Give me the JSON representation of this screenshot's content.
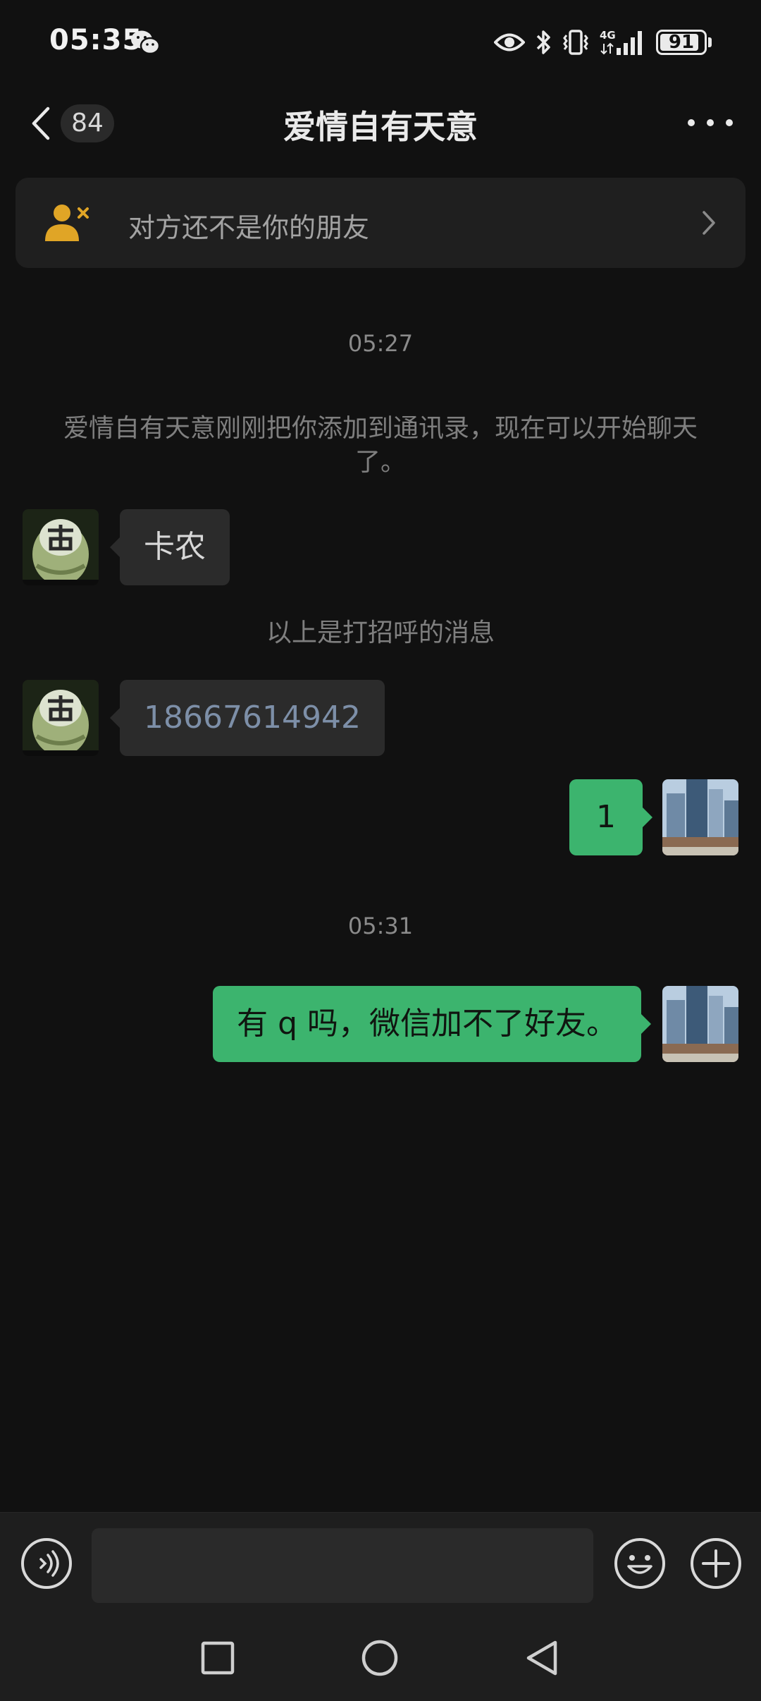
{
  "status_bar": {
    "time": "05:35",
    "battery": "91",
    "battery_level": 0.91,
    "network": "4G",
    "icons": [
      "wechat-icon",
      "eye-icon",
      "bluetooth-icon",
      "vibrate-icon",
      "signal-icon",
      "battery-icon"
    ]
  },
  "header": {
    "unread_count": "84",
    "title": "爱情自有天意"
  },
  "banner": {
    "text": "对方还不是你的朋友"
  },
  "messages": {
    "time_1": "05:27",
    "system_added": "爱情自有天意刚刚把你添加到通讯录，现在可以开始聊天了。",
    "msg_1": "卡农",
    "greeting_divider": "以上是打招呼的消息",
    "msg_2": "18667614942",
    "msg_3": "1",
    "time_2": "05:31",
    "msg_4": "有 q 吗，微信加不了好友。"
  },
  "input_bar": {
    "value": ""
  },
  "colors": {
    "background": "#111111",
    "outgoing_bubble": "#3cb46e",
    "incoming_bubble": "#2b2b2b",
    "link_text": "#7d8fa8",
    "warning_icon": "#e0a526"
  }
}
